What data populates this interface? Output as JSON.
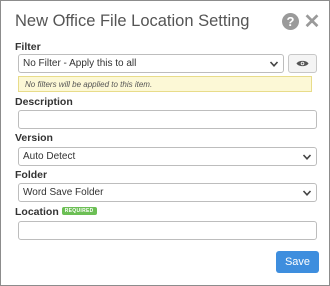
{
  "dialog": {
    "title": "New Office File Location Setting",
    "help_icon": "question-circle-icon",
    "close_icon": "close-icon"
  },
  "filter": {
    "label": "Filter",
    "selected": "No Filter - Apply this to all",
    "preview_icon": "eye-icon",
    "notice": "No filters will be applied to this item."
  },
  "description": {
    "label": "Description",
    "value": ""
  },
  "version": {
    "label": "Version",
    "selected": "Auto Detect"
  },
  "folder": {
    "label": "Folder",
    "selected": "Word Save Folder"
  },
  "location": {
    "label": "Location",
    "required_badge": "REQUIRED",
    "value": ""
  },
  "actions": {
    "save_label": "Save"
  },
  "colors": {
    "primary": "#3e8ede",
    "required": "#6cbf55",
    "notice_bg": "#fcf8d6"
  }
}
